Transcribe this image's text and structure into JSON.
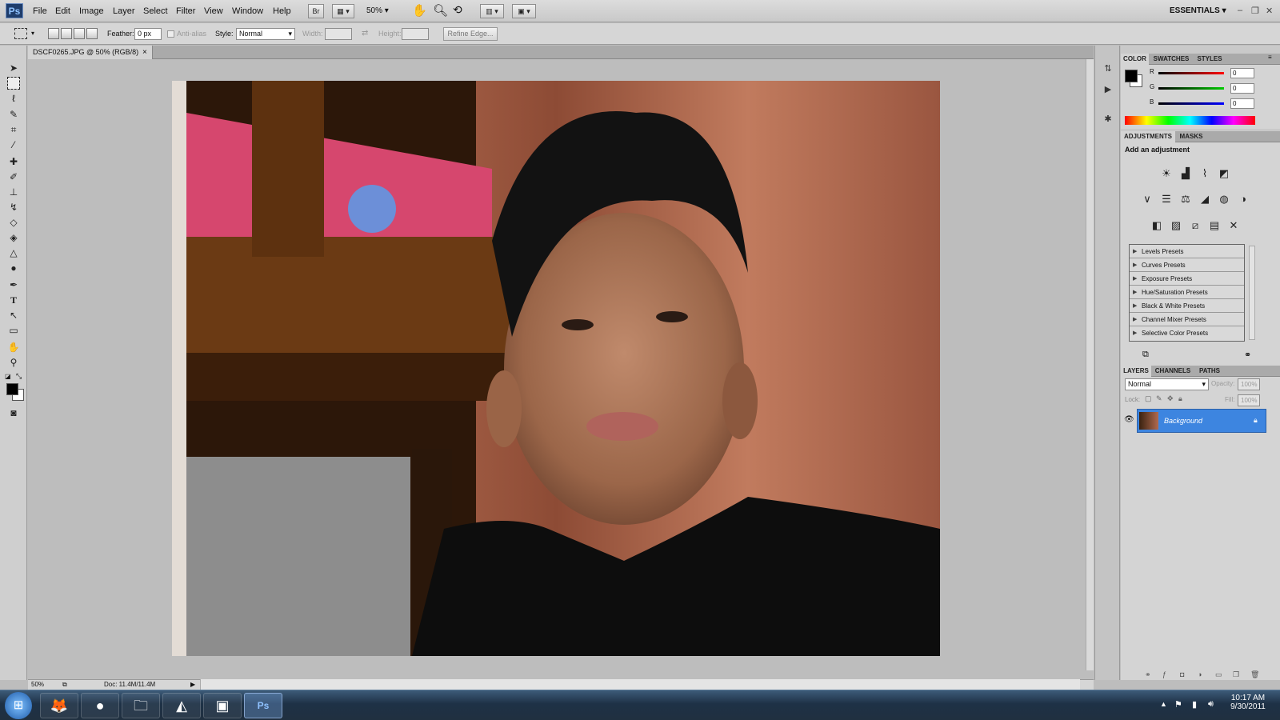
{
  "app": {
    "logo": "Ps",
    "workspace": "ESSENTIALS"
  },
  "menu": [
    "File",
    "Edit",
    "Image",
    "Layer",
    "Select",
    "Filter",
    "View",
    "Window",
    "Help"
  ],
  "menubar": {
    "bridge": "Br",
    "zoom": "50%"
  },
  "options": {
    "feather_label": "Feather:",
    "feather_value": "0 px",
    "antialias_label": "Anti-alias",
    "style_label": "Style:",
    "style_value": "Normal",
    "width_label": "Width:",
    "height_label": "Height:",
    "refine_edge": "Refine Edge..."
  },
  "document": {
    "tab_title": "DSCF0265.JPG @ 50% (RGB/8)",
    "close": "×",
    "zoom": "50%",
    "doc_info": "Doc: 11.4M/11.4M"
  },
  "color_panel": {
    "tabs": [
      "COLOR",
      "SWATCHES",
      "STYLES"
    ],
    "channels": [
      {
        "label": "R",
        "value": "0"
      },
      {
        "label": "G",
        "value": "0"
      },
      {
        "label": "B",
        "value": "0"
      }
    ]
  },
  "adjustments_panel": {
    "tabs": [
      "ADJUSTMENTS",
      "MASKS"
    ],
    "heading": "Add an adjustment",
    "presets": [
      "Levels Presets",
      "Curves Presets",
      "Exposure Presets",
      "Hue/Saturation Presets",
      "Black & White Presets",
      "Channel Mixer Presets",
      "Selective Color Presets"
    ]
  },
  "layers_panel": {
    "tabs": [
      "LAYERS",
      "CHANNELS",
      "PATHS"
    ],
    "blend_mode": "Normal",
    "opacity_label": "Opacity:",
    "opacity_value": "100%",
    "lock_label": "Lock:",
    "fill_label": "Fill:",
    "fill_value": "100%",
    "layers": [
      {
        "name": "Background"
      }
    ]
  },
  "taskbar": {
    "time": "10:17 AM",
    "date": "9/30/2011"
  },
  "colors": {
    "selection_blue": "#3d85e0",
    "ps_blue": "#1f3d6b"
  }
}
